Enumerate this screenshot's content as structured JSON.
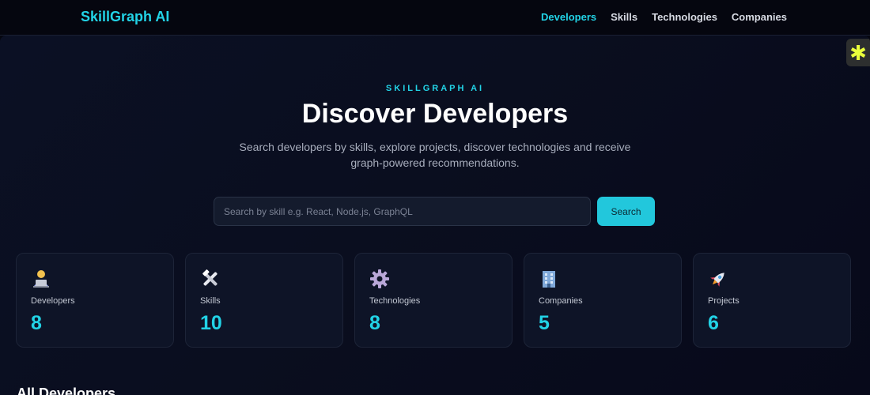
{
  "nav": {
    "brand": "SkillGraph AI",
    "links": [
      {
        "label": "Developers",
        "active": true
      },
      {
        "label": "Skills",
        "active": false
      },
      {
        "label": "Technologies",
        "active": false
      },
      {
        "label": "Companies",
        "active": false
      }
    ]
  },
  "hero": {
    "eyebrow": "SKILLGRAPH AI",
    "title": "Discover Developers",
    "subtitle": "Search developers by skills, explore projects, discover technologies and receive graph-powered recommendations."
  },
  "search": {
    "placeholder": "Search by skill e.g. React, Node.js, GraphQL",
    "value": "",
    "button_label": "Search"
  },
  "stats": [
    {
      "icon": "developer-icon",
      "label": "Developers",
      "value": "8"
    },
    {
      "icon": "tools-icon",
      "label": "Skills",
      "value": "10"
    },
    {
      "icon": "gear-icon",
      "label": "Technologies",
      "value": "8"
    },
    {
      "icon": "building-icon",
      "label": "Companies",
      "value": "5"
    },
    {
      "icon": "rocket-icon",
      "label": "Projects",
      "value": "6"
    }
  ],
  "section": {
    "title": "All Developers"
  },
  "colors": {
    "accent": "#22d3e6",
    "background": "#05060f",
    "card": "#0e1427",
    "button": "#22c7dc"
  }
}
